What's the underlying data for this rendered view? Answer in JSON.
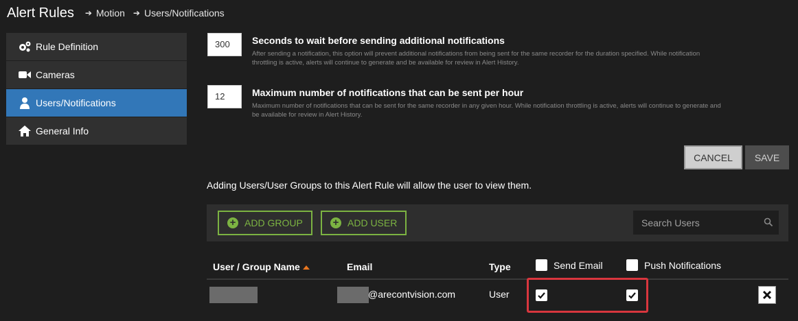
{
  "header": {
    "title": "Alert Rules",
    "breadcrumbs": [
      "Motion",
      "Users/Notifications"
    ]
  },
  "sidebar": {
    "items": [
      {
        "label": "Rule Definition",
        "icon": "gears-icon",
        "active": false
      },
      {
        "label": "Cameras",
        "icon": "video-camera-icon",
        "active": false
      },
      {
        "label": "Users/Notifications",
        "icon": "user-icon",
        "active": true
      },
      {
        "label": "General Info",
        "icon": "home-icon",
        "active": false
      }
    ]
  },
  "settings": {
    "wait": {
      "value": "300",
      "title": "Seconds to wait before sending additional notifications",
      "description": "After sending a notification, this option will prevent additional notifications from being sent for the same recorder for the duration specified. While notification throttling is active, alerts will continue to generate and be available for review in Alert History."
    },
    "max_per_hour": {
      "value": "12",
      "title": "Maximum number of notifications that can be sent per hour",
      "description": "Maximum number of notifications that can be sent for the same recorder in any given hour. While notification throttling is active, alerts will continue to generate and be available for review in Alert History."
    }
  },
  "actions": {
    "cancel_label": "CANCEL",
    "save_label": "SAVE"
  },
  "info_text": "Adding Users/User Groups to this Alert Rule will allow the user to view them.",
  "toolbar": {
    "add_group_label": "ADD GROUP",
    "add_user_label": "ADD USER",
    "search_placeholder": "Search Users"
  },
  "table": {
    "columns": {
      "name": "User / Group Name",
      "email": "Email",
      "type": "Type",
      "send_email": "Send Email",
      "push": "Push Notifications"
    },
    "header_checks": {
      "send_email": false,
      "push": false
    },
    "sort": {
      "column": "name",
      "direction": "ascending"
    },
    "rows": [
      {
        "email_domain": "@arecontvision.com",
        "type": "User",
        "send_email": true,
        "push": true
      }
    ]
  },
  "colors": {
    "background": "#1e1e1e",
    "accent_active": "#3277b8",
    "add_button_green": "#7cb342",
    "highlight_red": "#d9363e",
    "sort_orange": "#e8761f"
  }
}
